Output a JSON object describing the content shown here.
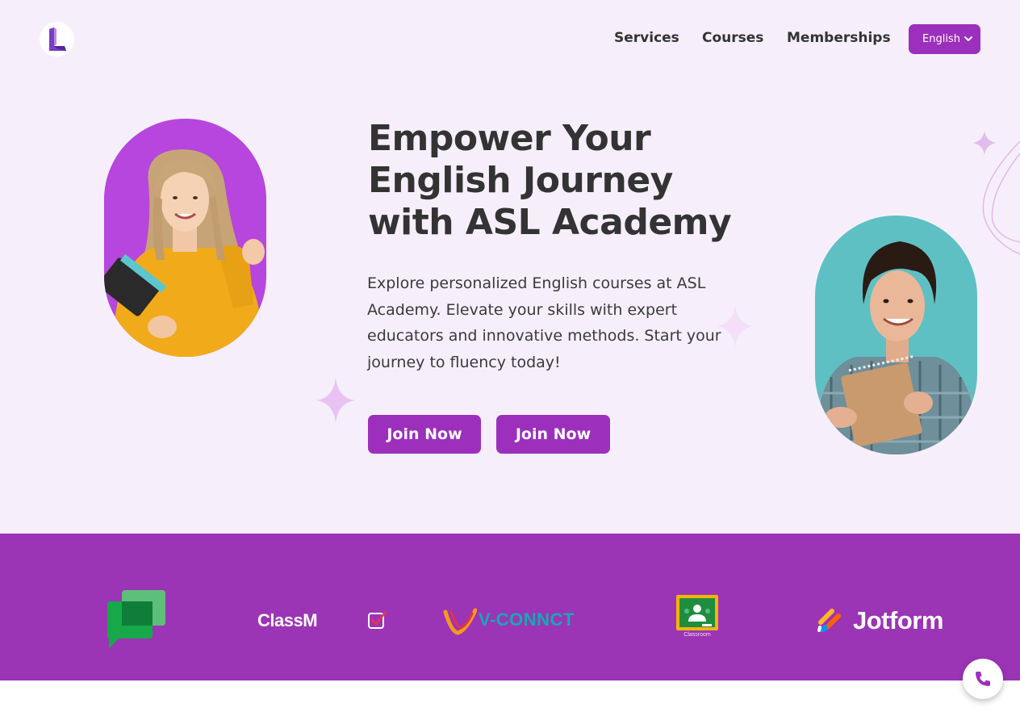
{
  "header": {
    "logo_icon": "academy-logo-icon",
    "nav": [
      "Services",
      "Courses",
      "Memberships"
    ],
    "language": {
      "selected": "English",
      "icon": "chevron-down-icon"
    }
  },
  "hero": {
    "headline": "Empower Your English Journey with ASL Academy",
    "description": "Explore personalized English courses at ASL Academy. Elevate your skills with expert educators and innovative methods. Start your journey to fluency today!",
    "buttons": [
      "Join Now",
      "Join Now"
    ],
    "left_photo": "student-woman-photo",
    "right_photo": "student-man-photo"
  },
  "partners": [
    {
      "icon": "google-chat-logo-icon"
    },
    {
      "text": "ClassM"
    },
    {
      "icon": "checkbox-logo-icon"
    },
    {
      "text": "V-CONNCT",
      "icon": "vconnct-logo-icon"
    },
    {
      "text": "Classroom",
      "icon": "google-classroom-logo-icon"
    },
    {
      "text": "Jotform",
      "icon": "jotform-logo-icon"
    }
  ],
  "call_button": {
    "icon": "phone-icon"
  },
  "colors": {
    "accent": "#9c2fbc",
    "hero_bg": "#f6effb",
    "band_bg": "#9c34b6",
    "left_pill": "#b646de",
    "right_pill": "#5fc0c3"
  }
}
